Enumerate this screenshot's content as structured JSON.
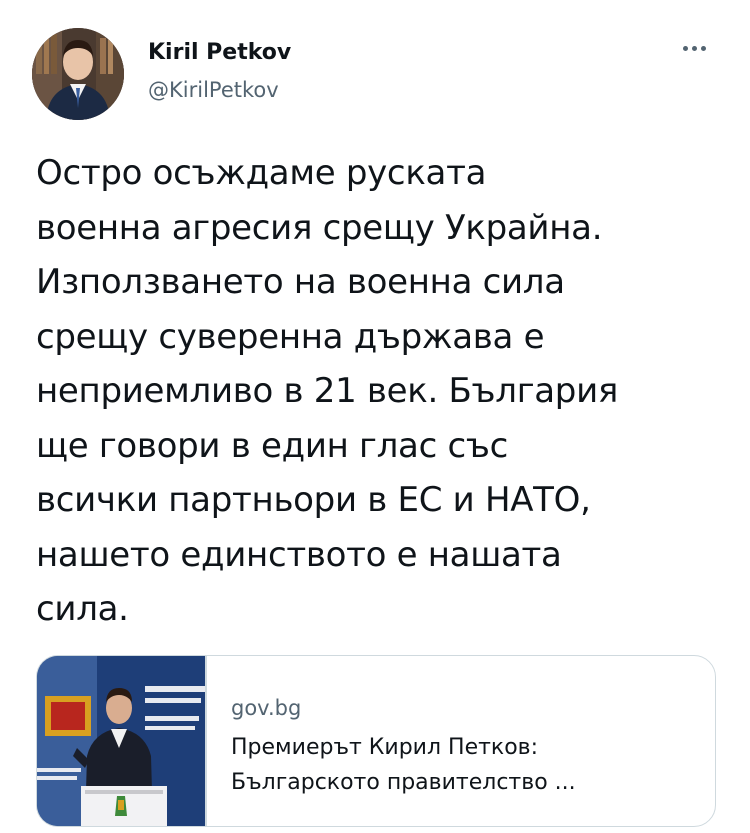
{
  "author": {
    "name": "Kiril Petkov",
    "handle": "@KirilPetkov",
    "avatar_icon": "profile-photo"
  },
  "menu": {
    "icon": "more-horizontal-icon"
  },
  "tweet": {
    "lines": [
      "Остро осъждаме руската",
      "военна агресия срещу Украйна.",
      "Използването на военна сила",
      "срещу суверенна държава е",
      "неприемливо в 21 век. България",
      "ще говори в един глас със",
      "всички партньори в ЕС и НАТО,",
      "нашето единството е нашата",
      "сила."
    ]
  },
  "link_card": {
    "domain": "gov.bg",
    "title_lines": [
      "Премиерът Кирил Петков:",
      "Българското правителство ..."
    ],
    "image_icon": "press-conference-photo"
  },
  "colors": {
    "text": "#0f1419",
    "secondary": "#536471",
    "border": "#cfd9de"
  }
}
